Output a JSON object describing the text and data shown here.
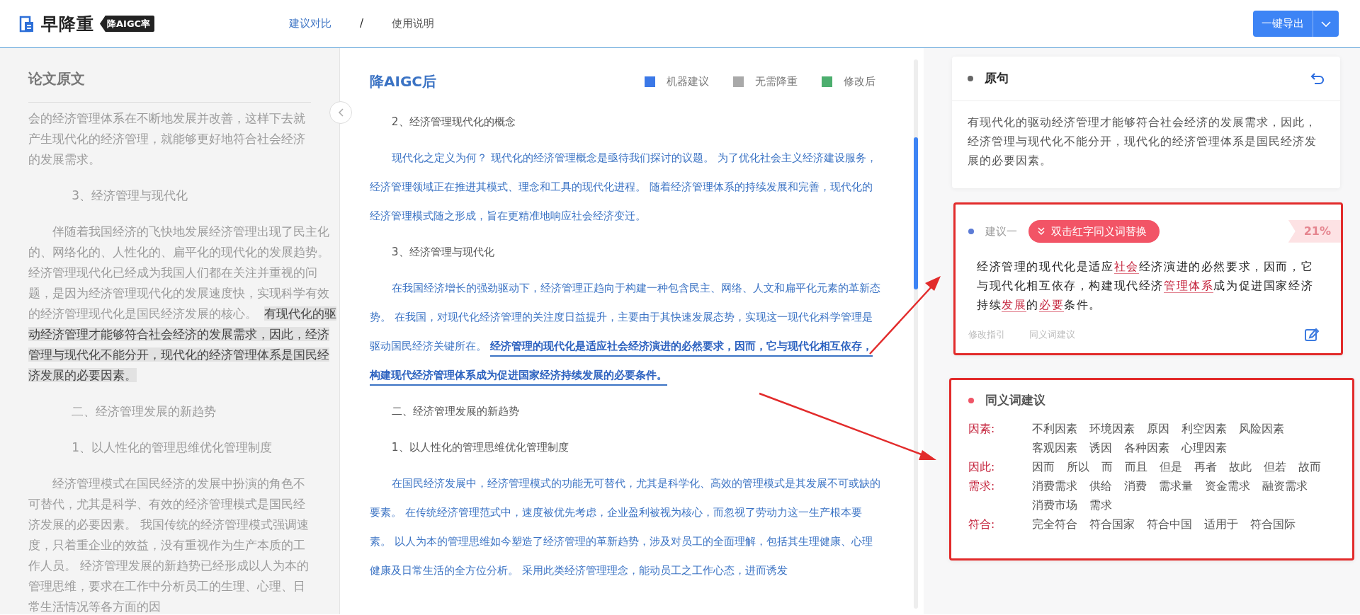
{
  "header": {
    "logo": {
      "name": "早降重",
      "badge": "降AIGC率"
    },
    "nav": [
      {
        "label": "建议对比",
        "selected": true
      },
      {
        "label": "使用说明",
        "selected": false
      }
    ],
    "nav_separator": "/",
    "export_button": {
      "label": "一键导出"
    }
  },
  "original_panel": {
    "title": "论文原文",
    "paragraphs": [
      {
        "kind": "continuation",
        "text": "会的经济管理体系在不断地发展并改善，这样下去就产生现代化的经济管理，就能够更好地符合社会经济的发展需求。"
      },
      {
        "kind": "heading",
        "text": "3、经济管理与现代化"
      },
      {
        "kind": "lines",
        "lines": [
          [
            {
              "text": "伴随着我国经济的飞快地发展经济管理出现了民主化",
              "highlighted": false
            }
          ],
          [
            {
              "text": "的、网络化的、人性化的、扁平化的现代化的发展趋势。",
              "highlighted": false
            }
          ],
          [
            {
              "text": "经济管理现代化已经成为我国人们都在关注并重视的问",
              "highlighted": false
            }
          ],
          [
            {
              "text": "题，是因为经济管理现代化的发展速度快，实现科学有效",
              "highlighted": false
            }
          ],
          [
            {
              "text": "的经济管理现代化是国民经济发展的核心。",
              "highlighted": false
            },
            {
              "text": "有现代化的驱",
              "highlighted": true
            }
          ],
          [
            {
              "text": "动经济管理才能够符合社会经济的发展需求，因此，经济",
              "highlighted": true
            }
          ],
          [
            {
              "text": "管理与现代化不能分开，现代化的经济管理体系是国民经",
              "highlighted": true
            }
          ],
          [
            {
              "text": "济发展的必要因素。",
              "highlighted": true
            }
          ]
        ]
      },
      {
        "kind": "heading",
        "text": "二、经济管理发展的新趋势"
      },
      {
        "kind": "heading",
        "text": "1、以人性化的管理思维优化管理制度"
      },
      {
        "kind": "body",
        "text": "经济管理模式在国民经济的发展中扮演的角色不可替代，尤其是科学、有效的经济管理模式是国民经济发展的必要因素。 我国传统的经济管理模式强调速度，只着重企业的效益，没有重视作为生产本质的工作人员。 经济管理发展的新趋势已经形成以人为本的管理思维，要求在工作中分析员工的生理、心理、日常生活情况等各方面的因"
      }
    ]
  },
  "revised_panel": {
    "title": "降AIGC后",
    "legend": [
      {
        "label": "机器建议",
        "color": "#3b78e7"
      },
      {
        "label": "无需降重",
        "color": "#a9a9a9"
      },
      {
        "label": "修改后",
        "color": "#4cae6e"
      }
    ],
    "paragraphs": [
      {
        "kind": "heading",
        "text": "2、经济管理现代化的概念"
      },
      {
        "kind": "body",
        "text": "现代化之定义为何？ 现代化的经济管理概念是亟待我们探讨的议题。 为了优化社会主义经济建设服务，经济管理领域正在推进其模式、理念和工具的现代化进程。 随着经济管理体系的持续发展和完善，现代化的经济管理模式随之形成，旨在更精准地响应社会经济变迁。"
      },
      {
        "kind": "heading",
        "text": "3、经济管理与现代化"
      },
      {
        "kind": "body",
        "text": "在我国经济增长的强劲驱动下，经济管理正趋向于构建一种包含民主、网络、人文和扁平化元素的革新态势。 在我国，对现代化经济管理的关注度日益提升，主要由于其快速发展态势，实现这一现代化科学管理是驱动国民经济关键所在。 **经济管理的现代化是适应社会经济演进的必然要求，因而，它与现代化相互依存，构建现代经济管理体系成为促进国家经济持续发展的必要条件。**"
      },
      {
        "kind": "heading",
        "text": "二、经济管理发展的新趋势"
      },
      {
        "kind": "heading",
        "text": "1、以人性化的管理思维优化管理制度"
      },
      {
        "kind": "body",
        "text": "在国民经济发展中，经济管理模式的功能无可替代，尤其是科学化、高效的管理模式是其发展不可或缺的要素。 在传统经济管理范式中，速度被优先考虑，企业盈利被视为核心，而忽视了劳动力这一生产根本要素。 以人为本的管理思维如今塑造了经济管理的革新趋势，涉及对员工的全面理解，包括其生理健康、心理健康及日常生活的全方位分析。 采用此类经济管理理念，能动员工之工作心态，进而诱发"
      }
    ]
  },
  "original_sentence": {
    "title": "原句",
    "text": "有现代化的驱动经济管理才能够符合社会经济的发展需求，因此，经济管理与现代化不能分开，现代化的经济管理体系是国民经济发展的必要因素。"
  },
  "suggestion": {
    "label": "建议一",
    "hint": "双击红字同义词替换",
    "percent": "21%",
    "lines": [
      [
        {
          "text": "经济管理的现代化是适应",
          "replaceable": false
        },
        {
          "text": "社会",
          "replaceable": true
        },
        {
          "text": "经济演进的必然要求，因而，它",
          "replaceable": false
        }
      ],
      [
        {
          "text": "与现代化相互依存，构建现代经济",
          "replaceable": false
        },
        {
          "text": "管理体系",
          "replaceable": true
        },
        {
          "text": "成为促进国家经济",
          "replaceable": false
        }
      ],
      [
        {
          "text": "持续",
          "replaceable": false
        },
        {
          "text": "发展",
          "replaceable": true
        },
        {
          "text": "的",
          "replaceable": false
        },
        {
          "text": "必要",
          "replaceable": true
        },
        {
          "text": "条件。",
          "replaceable": false
        }
      ]
    ],
    "links": [
      "修改指引",
      "同义词建议"
    ]
  },
  "synonyms": {
    "title": "同义词建议",
    "groups": [
      {
        "word": "因素:",
        "options": [
          "不利因素",
          "环境因素",
          "原因",
          "利空因素",
          "风险因素",
          "客观因素",
          "诱因",
          "各种因素",
          "心理因素"
        ]
      },
      {
        "word": "因此:",
        "options": [
          "因而",
          "所以",
          "而",
          "而且",
          "但是",
          "再者",
          "故此",
          "但若",
          "故而"
        ]
      },
      {
        "word": "需求:",
        "options": [
          "消费需求",
          "供给",
          "消费",
          "需求量",
          "资金需求",
          "融资需求",
          "消费市场",
          "需求"
        ]
      },
      {
        "word": "符合:",
        "options": [
          "完全符合",
          "符合国家",
          "符合中国",
          "适用于",
          "符合国际"
        ]
      }
    ]
  }
}
